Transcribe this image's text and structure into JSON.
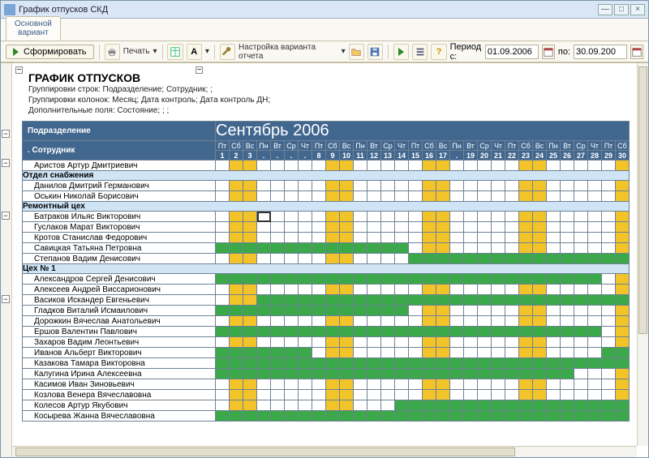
{
  "window": {
    "title": "График отпусков СКД"
  },
  "tabs": {
    "main": "Основной\nвариант"
  },
  "toolbar": {
    "form": "Сформировать",
    "print": "Печать",
    "settings": "Настройка варианта отчета"
  },
  "period": {
    "label_from": "Период с:",
    "from": "01.09.2006",
    "label_to": "по:",
    "to": "30.09.200"
  },
  "report": {
    "title": "ГРАФИК ОТПУСКОВ",
    "line1": "Группировки строк: Подразделение; Сотрудник; ;",
    "line2": "Группировки колонок: Месяц; Дата контроль; Дата контроль ДН;",
    "line3": "Дополнительные поля: Состояние; ; ;"
  },
  "header": {
    "col1": "Подразделение",
    "col2": ". Сотрудник",
    "month": "Сентябрь 2006",
    "dows": [
      "Пт",
      "Сб",
      "Вс",
      "Пн",
      "Вт",
      "Ср",
      "Чт",
      "Пт",
      "Сб",
      "Вс",
      "Пн",
      "Вт",
      "Ср",
      "Чт",
      "Пт",
      "Сб",
      "Вс",
      "Пн",
      "Вт",
      "Ср",
      "Чт",
      "Пт",
      "Сб",
      "Вс",
      "Пн",
      "Вт",
      "Ср",
      "Чт",
      "Пт",
      "Сб"
    ],
    "days": [
      "1",
      "2",
      "3",
      ".",
      ".",
      ".",
      ".",
      "8",
      "9",
      "10",
      "11",
      "12",
      "13",
      "14",
      "15",
      "16",
      "17",
      ".",
      "19",
      "20",
      "21",
      "22",
      "23",
      "24",
      "25",
      "26",
      "27",
      "28",
      "29",
      "30"
    ]
  },
  "weekend_cols": [
    1,
    2,
    8,
    9,
    15,
    16,
    22,
    23,
    29
  ],
  "rows": [
    {
      "type": "emp",
      "label": "Аристов Артур Дмитриевич",
      "vac": []
    },
    {
      "type": "grp",
      "label": "Отдел снабжения"
    },
    {
      "type": "emp",
      "label": "Данилов Дмитрий Германович",
      "vac": []
    },
    {
      "type": "emp",
      "label": "Оськин Николай Борисович",
      "vac": []
    },
    {
      "type": "grp",
      "label": "Ремонтный цех"
    },
    {
      "type": "emp",
      "label": "Батраков Ильяс Викторович",
      "vac": [],
      "cursor": 3
    },
    {
      "type": "emp",
      "label": "Гуслаков Марат Викторович",
      "vac": []
    },
    {
      "type": "emp",
      "label": "Кротов Станислав Федорович",
      "vac": []
    },
    {
      "type": "emp",
      "label": "Савицкая Татьяна Петровна",
      "vac": [
        0,
        1,
        2,
        3,
        4,
        5,
        6,
        7,
        8,
        9,
        10,
        11,
        12,
        13
      ]
    },
    {
      "type": "emp",
      "label": "Степанов Вадим Денисович",
      "vac": [
        14,
        15,
        16,
        17,
        18,
        19,
        20,
        21,
        22,
        23,
        24,
        25,
        26,
        27,
        28,
        29
      ]
    },
    {
      "type": "grp",
      "label": "Цех № 1"
    },
    {
      "type": "emp",
      "label": "Александров Сергей Денисович",
      "vac": [
        0,
        1,
        2,
        3,
        4,
        5,
        6,
        7,
        8,
        9,
        10,
        11,
        12,
        13,
        14,
        15,
        16,
        17,
        18,
        19,
        20,
        21,
        22,
        23,
        24,
        25,
        26,
        27
      ]
    },
    {
      "type": "emp",
      "label": "Алексеев Андрей Виссарионович",
      "vac": []
    },
    {
      "type": "emp",
      "label": "Васиков Искандер Евгеньевич",
      "vac": [
        3,
        4,
        5,
        6,
        7,
        8,
        9,
        10,
        11,
        12,
        13,
        14,
        15,
        16,
        17,
        18,
        19,
        20,
        21,
        22,
        23,
        24,
        25,
        26,
        27,
        28,
        29
      ]
    },
    {
      "type": "emp",
      "label": "Гладков Виталий Исмаилович",
      "vac": [
        0,
        1,
        2,
        3,
        4,
        5,
        6,
        7,
        8,
        9,
        10,
        11,
        12,
        13
      ]
    },
    {
      "type": "emp",
      "label": "Дорожкин Вячеслав Анатольевич",
      "vac": []
    },
    {
      "type": "emp",
      "label": "Ершов Валентин Павлович",
      "vac": [
        0,
        1,
        2,
        3,
        4,
        5,
        6,
        7,
        8,
        9,
        10,
        11,
        12,
        13,
        14,
        15,
        16,
        17,
        18,
        19,
        20,
        21,
        22,
        23,
        24,
        25,
        26,
        27
      ]
    },
    {
      "type": "emp",
      "label": "Захаров Вадим Леонтьевич",
      "vac": []
    },
    {
      "type": "emp",
      "label": "Иванов Альберт Викторович",
      "vac": [
        0,
        1,
        2,
        3,
        4,
        5,
        6,
        28,
        29
      ]
    },
    {
      "type": "emp",
      "label": "Казакова Тамара Викторовна",
      "vac": [
        0,
        1,
        2,
        3,
        4,
        5,
        6,
        7,
        8,
        9,
        10,
        11,
        12,
        13,
        14,
        15,
        16,
        17,
        18,
        19,
        20,
        21,
        22,
        23,
        24,
        25,
        26,
        27,
        28,
        29
      ]
    },
    {
      "type": "emp",
      "label": "Калугина Ирина Алексеевна",
      "vac": [
        0,
        1,
        2,
        3,
        4,
        5,
        6,
        7,
        8,
        9,
        10,
        11,
        12,
        13,
        14,
        15,
        16,
        17,
        18,
        19,
        20,
        21,
        22,
        23,
        24,
        25
      ]
    },
    {
      "type": "emp",
      "label": "Касимов Иван Зиновьевич",
      "vac": []
    },
    {
      "type": "emp",
      "label": "Козлова Венера Вячеславовна",
      "vac": []
    },
    {
      "type": "emp",
      "label": "Колесов Артур Якубович",
      "vac": [
        13,
        14,
        15,
        16,
        17,
        18,
        19,
        20,
        21,
        22,
        23,
        24,
        25,
        26,
        27,
        28,
        29
      ]
    },
    {
      "type": "emp",
      "label": "Косырева Жанна Вячеславовна",
      "vac": [
        0,
        1,
        2,
        3,
        4,
        5,
        6,
        7,
        8,
        9,
        10,
        11,
        12,
        13,
        14,
        15,
        16,
        17,
        18,
        19,
        20,
        21,
        22,
        23,
        24,
        25,
        26,
        27,
        28,
        29
      ]
    }
  ]
}
